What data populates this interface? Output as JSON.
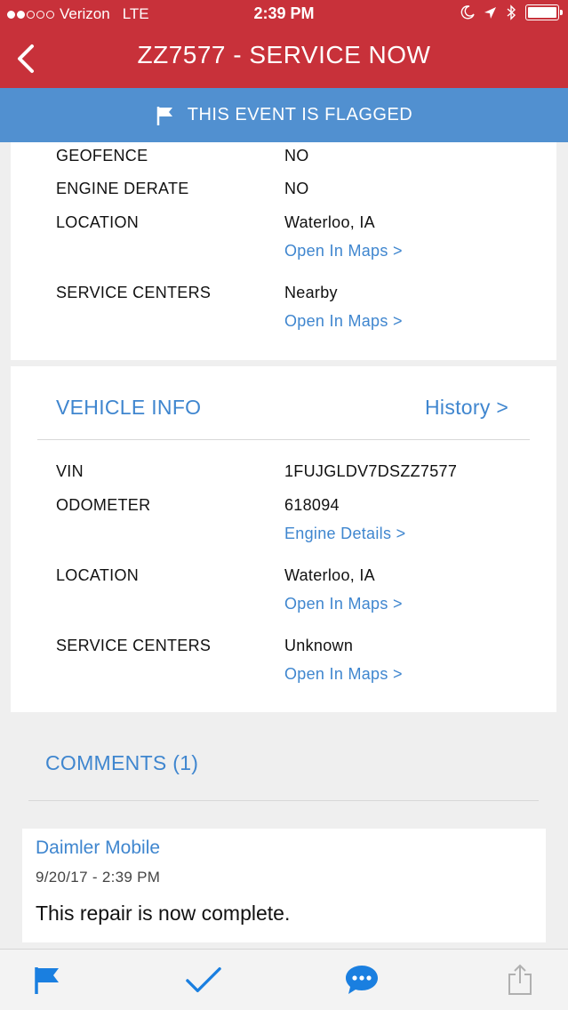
{
  "status_bar": {
    "carrier": "Verizon",
    "network": "LTE",
    "time": "2:39 PM",
    "signal_bars_filled": 2,
    "signal_bars_total": 5
  },
  "nav": {
    "title": "ZZ7577 - SERVICE NOW",
    "back_icon": "chevron-left-icon"
  },
  "flag_banner": {
    "text": "THIS EVENT IS FLAGGED",
    "icon": "flag-icon"
  },
  "event_details": {
    "geofence": {
      "label": "GEOFENCE",
      "value": "NO"
    },
    "engine_derate": {
      "label": "ENGINE DERATE",
      "value": "NO"
    },
    "location": {
      "label": "LOCATION",
      "value": "Waterloo, IA",
      "link": "Open In Maps >"
    },
    "service_centers": {
      "label": "SERVICE CENTERS",
      "value": "Nearby",
      "link": "Open In Maps >"
    }
  },
  "vehicle_info": {
    "title": "VEHICLE INFO",
    "history_link": "History >",
    "vin": {
      "label": "VIN",
      "value": "1FUJGLDV7DSZZ7577"
    },
    "odometer": {
      "label": "ODOMETER",
      "value": "618094",
      "link": "Engine Details >"
    },
    "location": {
      "label": "LOCATION",
      "value": "Waterloo, IA",
      "link": "Open In Maps >"
    },
    "service_centers": {
      "label": "SERVICE CENTERS",
      "value": "Unknown",
      "link": "Open In Maps >"
    }
  },
  "comments": {
    "title": "COMMENTS (1)",
    "items": [
      {
        "author": "Daimler Mobile",
        "timestamp": "9/20/17 - 2:39 PM",
        "text": "This repair is now complete."
      }
    ]
  },
  "tab_bar": {
    "tabs": [
      {
        "icon": "flag-icon"
      },
      {
        "icon": "checkmark-icon"
      },
      {
        "icon": "chat-bubble-icon"
      },
      {
        "icon": "share-icon"
      }
    ]
  },
  "colors": {
    "header_red": "#c8313a",
    "banner_blue": "#5190d0",
    "link_blue": "#3f86cf",
    "tab_active_blue": "#1a7fe0"
  }
}
